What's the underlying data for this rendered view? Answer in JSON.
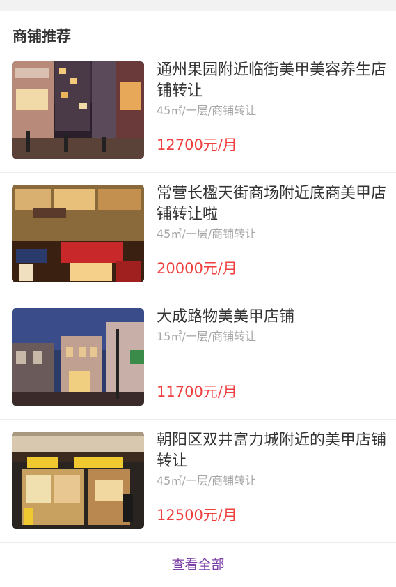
{
  "section": {
    "title": "商铺推荐"
  },
  "listings": [
    {
      "title": "通州果园附近临街美甲美容养生店铺转让",
      "meta": "45㎡/一层/商铺转让",
      "price": "12700元/月"
    },
    {
      "title": "常营长楹天街商场附近底商美甲店铺转让啦",
      "meta": "45㎡/一层/商铺转让",
      "price": "20000元/月"
    },
    {
      "title": "大成路物美美甲店铺",
      "meta": "15㎡/一层/商铺转让",
      "price": "11700元/月"
    },
    {
      "title": "朝阳区双井富力城附近的美甲店铺转让",
      "meta": "45㎡/一层/商铺转让",
      "price": "12500元/月"
    }
  ],
  "footer": {
    "view_all_label": "查看全部"
  },
  "colors": {
    "price": "#ef3f3f",
    "link": "#7b3fa8",
    "title": "#333333",
    "meta": "#a5a5a5"
  }
}
